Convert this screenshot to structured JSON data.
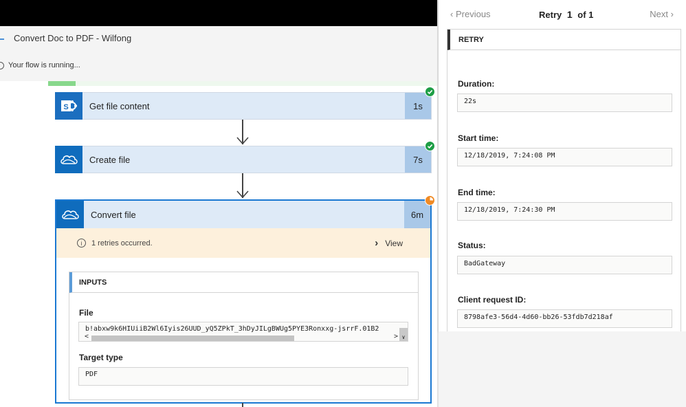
{
  "header": {
    "flow_title": "Convert Doc to PDF - Wilfong",
    "status_text": "Your flow is running..."
  },
  "flow": {
    "progress_fraction": 0.07,
    "steps": [
      {
        "title": "Get file content",
        "duration": "1s",
        "icon": "sharepoint-icon",
        "status": "succeeded"
      },
      {
        "title": "Create file",
        "duration": "7s",
        "icon": "onedrive-icon",
        "status": "succeeded"
      },
      {
        "title": "Convert file",
        "duration": "6m",
        "icon": "onedrive-icon",
        "status": "running"
      }
    ],
    "expanded": {
      "retry_message": "1 retries occurred.",
      "view_label": "View",
      "inputs_heading": "INPUTS",
      "fields": [
        {
          "label": "File",
          "value": "b!abxw9k6HIUiiB2Wl6Iyis26UUD_yQ5ZPkT_3hDyJILgBWUg5PYE3Ronxxg-jsrrF.01B2"
        },
        {
          "label": "Target type",
          "value": "PDF"
        }
      ]
    }
  },
  "panel": {
    "previous_label": "Previous",
    "next_label": "Next",
    "counter_prefix": "Retry",
    "counter_current": "1",
    "counter_suffix": "of 1",
    "section_heading": "RETRY",
    "fields": [
      {
        "label": "Duration:",
        "value": "22s"
      },
      {
        "label": "Start time:",
        "value": "12/18/2019, 7:24:08 PM"
      },
      {
        "label": "End time:",
        "value": "12/18/2019, 7:24:30 PM"
      },
      {
        "label": "Status:",
        "value": "BadGateway"
      },
      {
        "label": "Client request ID:",
        "value": "8798afe3-56d4-4d60-bb26-53fdb7d218af"
      }
    ]
  },
  "colors": {
    "accent_blue": "#0f6cbd",
    "success_green": "#1e9e46",
    "running_orange": "#f08a24",
    "warning_bg": "#fdf0dc"
  }
}
